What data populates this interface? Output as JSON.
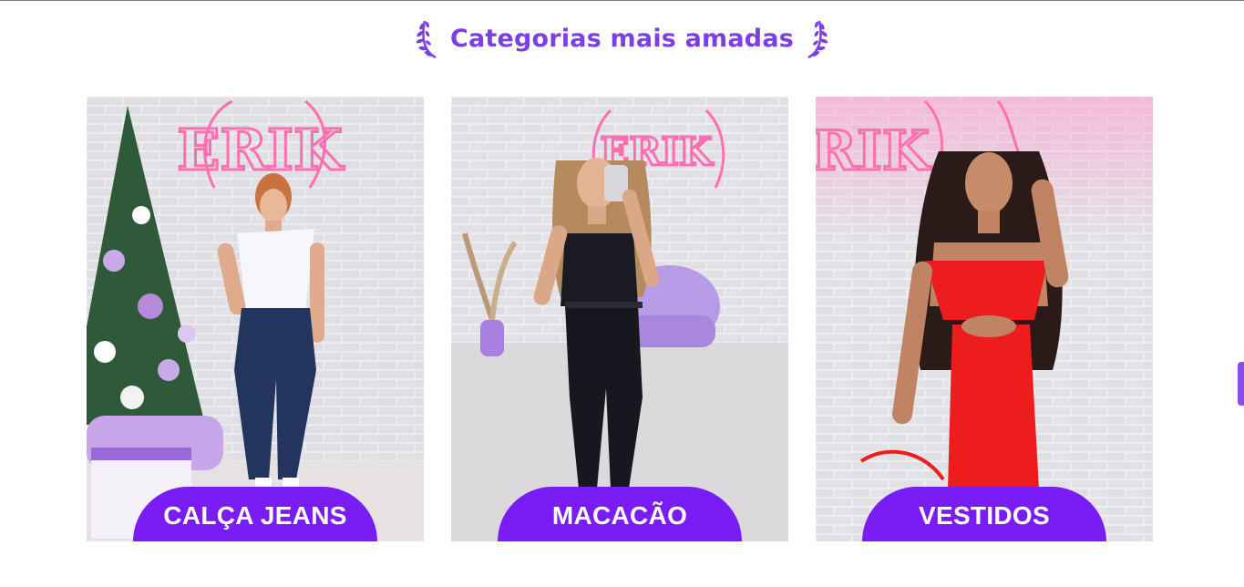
{
  "section": {
    "title": "Categorias mais amadas"
  },
  "categories": [
    {
      "label": "CALÇA JEANS",
      "icon": "woman-jeans-photo"
    },
    {
      "label": "MACACÃO",
      "icon": "woman-jumpsuit-photo"
    },
    {
      "label": "VESTIDOS",
      "icon": "woman-red-dress-photo"
    }
  ],
  "colors": {
    "accent": "#7a1cf4",
    "heading": "#7b3fe4"
  }
}
